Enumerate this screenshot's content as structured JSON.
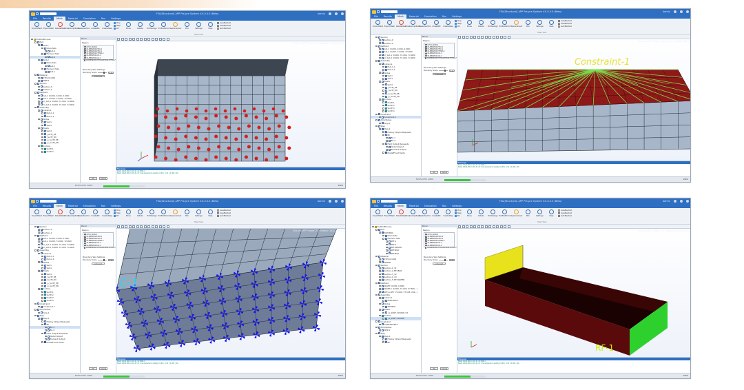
{
  "app": {
    "window_title": "FEA(Structural) APP Pre-pre System V.0.0.0.0 (Beta)",
    "quick_search": "",
    "user": "Admin",
    "tabs": [
      "File",
      "Results",
      "Mesh",
      "Material",
      "Simulation",
      "Run",
      "Settings"
    ],
    "active_tab": 2,
    "ribbon_buttons": [
      {
        "label": "ImportMesh",
        "icon": "import-icon",
        "color": "#3a6fb7"
      },
      {
        "label": "ExportMesh",
        "icon": "export-icon",
        "color": "#3a6fb7"
      },
      {
        "label": "DeleteMesh",
        "icon": "delete-icon",
        "color": "#e0463a"
      },
      {
        "label": "CreateAmplitude",
        "icon": "amplitude-icon",
        "color": "#3a6fb7"
      },
      {
        "label": "CreateSection",
        "icon": "section-icon",
        "color": "#3a6fb7"
      },
      {
        "label": "CreateBC",
        "icon": "bc-icon",
        "color": "#3a6fb7"
      },
      {
        "label": "CreateStep",
        "icon": "step-icon",
        "color": "#3a6fb7"
      }
    ],
    "ribbon_small": [
      "Prop",
      "Step",
      "BC"
    ],
    "ribbon_tools": [
      {
        "label": "Move",
        "icon": "move-icon",
        "color": "#3a6fb7"
      },
      {
        "label": "Rotate",
        "icon": "rotate-icon",
        "color": "#3a6fb7"
      },
      {
        "label": "ProfileAlign",
        "icon": "align-icon",
        "color": "#3a6fb7"
      },
      {
        "label": "ProfileMirror",
        "icon": "mirror-icon",
        "color": "#3a6fb7"
      },
      {
        "label": "Displacement",
        "icon": "displacement-icon",
        "color": "#e5a23a"
      },
      {
        "label": "Pick",
        "icon": "pick-icon",
        "color": "#3a6fb7"
      },
      {
        "label": "Settings",
        "icon": "gear-icon",
        "color": "#3a6fb7"
      },
      {
        "label": "Help",
        "icon": "help-icon",
        "color": "#3a6fb7"
      }
    ],
    "ribbon_checks": [
      "viewMeshed",
      "viewMeshed",
      "autoMeshed"
    ],
    "group_label": "Mesh Tools",
    "viewer_caption": "Struct APP Frame 2.0 Viewer 1440X900-1",
    "panel_header": "Panel",
    "panel_label": "Region",
    "panel_rows": [
      "CPS 1(1040)",
      "OLMBEZOR-HEX-2",
      "OLMBEZOR-HEX-1",
      "OLMBEZOR-TETRA-1",
      "OLMBEZOR-CO-1",
      "OLMBEZOR-CO-2",
      "OLMBEZOR-TETRA-BEZOR-TETRA-HEX"
    ],
    "panel_section": "Boundary Size Settings",
    "panel_field": "Boundary Scale",
    "panel_value": "0.16",
    "panel_apply": "solve set",
    "panel_ok": "OK",
    "panel_cancel": "Cancel",
    "msg_header": "Message",
    "msg_lines": [
      "Mesh    2022-06-01 16 41 19 SNO-1",
      "Mesh    2022-06-01 16 41 27   check element quality (0.69 | 0.12 | 0.98) | OK"
    ],
    "status_text": "Fill   0%   0    Thr 1.00%",
    "status_pct": "100%",
    "status_progress": 0.64
  },
  "windows": [
    {
      "id": "w1",
      "tree": [
        {
          "label": "PrePostProcess",
          "lvl": 0,
          "icon": "yel"
        },
        {
          "label": "Part",
          "lvl": 1,
          "icon": ""
        },
        {
          "label": "Part-1",
          "lvl": 2,
          "icon": "blu"
        },
        {
          "label": "Node Sets",
          "lvl": 3,
          "icon": ""
        },
        {
          "label": "Set-4",
          "lvl": 4,
          "icon": ""
        },
        {
          "label": "Element Sets",
          "lvl": 3,
          "icon": ""
        },
        {
          "label": "Set-4",
          "lvl": 4,
          "icon": "",
          "sel": true
        },
        {
          "label": "Part-2",
          "lvl": 2,
          "icon": "blu"
        },
        {
          "label": "Node Sets",
          "lvl": 3,
          "icon": ""
        },
        {
          "label": "Set-1",
          "lvl": 4,
          "icon": ""
        },
        {
          "label": "Element Sets",
          "lvl": 3,
          "icon": ""
        },
        {
          "label": "Set-1",
          "lvl": 4,
          "icon": ""
        },
        {
          "label": "Material",
          "lvl": 1,
          "icon": ""
        },
        {
          "label": "STP-02-1991",
          "lvl": 2,
          "icon": ""
        },
        {
          "label": "SNE71",
          "lvl": 2,
          "icon": ""
        },
        {
          "label": "Section",
          "lvl": 1,
          "icon": ""
        },
        {
          "label": "Section-0",
          "lvl": 2,
          "icon": ""
        },
        {
          "label": "Section-1",
          "lvl": 2,
          "icon": ""
        },
        {
          "label": "NetPoint",
          "lvl": 1,
          "icon": ""
        },
        {
          "label": "bot-1 (0.000, 0.000, 0.000)",
          "lvl": 2,
          "icon": ""
        },
        {
          "label": "bot-1 (0.000, 72.000, 72.000)",
          "lvl": 2,
          "icon": ""
        },
        {
          "label": "m_bot-1 (0.000, 72.000, 72.000)",
          "lvl": 2,
          "icon": ""
        },
        {
          "label": "m_bot-2 (0.000, 72.000, 72.000)",
          "lvl": 2,
          "icon": ""
        },
        {
          "label": "Assembly",
          "lvl": 1,
          "icon": ""
        },
        {
          "label": "Instance",
          "lvl": 2,
          "icon": ""
        },
        {
          "label": "Part-1-1",
          "lvl": 3,
          "icon": ""
        },
        {
          "label": "Part-2-1",
          "lvl": 3,
          "icon": ""
        },
        {
          "label": "Nodes",
          "lvl": 2,
          "icon": ""
        },
        {
          "label": "Set-1",
          "lvl": 3,
          "icon": ""
        },
        {
          "label": "Set-4",
          "lvl": 3,
          "icon": ""
        },
        {
          "label": "Elsets",
          "lvl": 2,
          "icon": ""
        },
        {
          "label": "Set-4",
          "lvl": 3,
          "icon": ""
        },
        {
          "label": "_SurfP_3B",
          "lvl": 3,
          "icon": ""
        },
        {
          "label": "_SurfP_3N",
          "lvl": 3,
          "icon": ""
        },
        {
          "label": "_p_SurfP_3B",
          "lvl": 3,
          "icon": ""
        },
        {
          "label": "_p_SurfP_3N",
          "lvl": 3,
          "icon": ""
        },
        {
          "label": "Surface",
          "lvl": 2,
          "icon": "cyn"
        },
        {
          "label": "SurfP-1",
          "lvl": 3,
          "icon": "cyn"
        },
        {
          "label": "SurfP-2",
          "lvl": 3,
          "icon": "cyn"
        }
      ],
      "scene": "nodes"
    },
    {
      "id": "w2",
      "tree": [
        {
          "label": "Section",
          "lvl": 1,
          "icon": ""
        },
        {
          "label": "Section-0",
          "lvl": 2,
          "icon": ""
        },
        {
          "label": "Section-1",
          "lvl": 2,
          "icon": ""
        },
        {
          "label": "NetPoint",
          "lvl": 1,
          "icon": ""
        },
        {
          "label": "bot-1 (0.000, 0.000, 0.000)",
          "lvl": 2,
          "icon": ""
        },
        {
          "label": "bot-1 (0.000, 72.000, 72.000)",
          "lvl": 2,
          "icon": ""
        },
        {
          "label": "m_bot-1 (0.000, 72.000, 72.000)",
          "lvl": 2,
          "icon": ""
        },
        {
          "label": "m_bot-2 (0.000, 72.000, 72.000)",
          "lvl": 2,
          "icon": ""
        },
        {
          "label": "Assembly",
          "lvl": 1,
          "icon": ""
        },
        {
          "label": "Instance",
          "lvl": 2,
          "icon": ""
        },
        {
          "label": "Part-1-1",
          "lvl": 3,
          "icon": ""
        },
        {
          "label": "Part-2-1",
          "lvl": 3,
          "icon": ""
        },
        {
          "label": "Nodes",
          "lvl": 2,
          "icon": ""
        },
        {
          "label": "Set-1",
          "lvl": 3,
          "icon": ""
        },
        {
          "label": "Set-4",
          "lvl": 3,
          "icon": ""
        },
        {
          "label": "Elsets",
          "lvl": 2,
          "icon": ""
        },
        {
          "label": "Set-4",
          "lvl": 3,
          "icon": ""
        },
        {
          "label": "_SurfP_3B",
          "lvl": 3,
          "icon": ""
        },
        {
          "label": "_SurfP_3N",
          "lvl": 3,
          "icon": ""
        },
        {
          "label": "_p_SurfP_3B",
          "lvl": 3,
          "icon": ""
        },
        {
          "label": "_p_SurfP_3N",
          "lvl": 3,
          "icon": ""
        },
        {
          "label": "Surface",
          "lvl": 2,
          "icon": "cyn"
        },
        {
          "label": "SurfP-1",
          "lvl": 3,
          "icon": "cyn"
        },
        {
          "label": "SurfP-2",
          "lvl": 3,
          "icon": "cyn"
        },
        {
          "label": "SurfP-3",
          "lvl": 3,
          "icon": "cyn"
        },
        {
          "label": "SurfP-4",
          "lvl": 3,
          "icon": "cyn"
        },
        {
          "label": "Constraint",
          "lvl": 1,
          "icon": ""
        },
        {
          "label": "Constraint-1",
          "lvl": 2,
          "icon": "",
          "sel": true
        },
        {
          "label": "Amplitudes",
          "lvl": 1,
          "icon": ""
        },
        {
          "label": "Amp-1",
          "lvl": 2,
          "icon": ""
        },
        {
          "label": "Step",
          "lvl": 1,
          "icon": ""
        },
        {
          "label": "Step-1",
          "lvl": 2,
          "icon": "blu"
        },
        {
          "label": "History Output Requests",
          "lvl": 3,
          "icon": ""
        },
        {
          "label": "BC",
          "lvl": 3,
          "icon": ""
        },
        {
          "label": "BC-1",
          "lvl": 4,
          "icon": ""
        },
        {
          "label": "BC-2",
          "lvl": 4,
          "icon": ""
        },
        {
          "label": "Field Output Requests",
          "lvl": 3,
          "icon": ""
        },
        {
          "label": "Nodal Output",
          "lvl": 4,
          "icon": ""
        },
        {
          "label": "Element Output",
          "lvl": 4,
          "icon": ""
        },
        {
          "label": "PredefFined Fields",
          "lvl": 3,
          "icon": "blu"
        }
      ],
      "scene": "constraint",
      "label": "Constraint-1"
    },
    {
      "id": "w3",
      "tree": [
        {
          "label": "Section",
          "lvl": 1,
          "icon": ""
        },
        {
          "label": "Section-0",
          "lvl": 2,
          "icon": ""
        },
        {
          "label": "Section-1",
          "lvl": 2,
          "icon": ""
        },
        {
          "label": "NetPoint",
          "lvl": 1,
          "icon": ""
        },
        {
          "label": "bot-1 (0.000, 0.000, 0.000)",
          "lvl": 2,
          "icon": ""
        },
        {
          "label": "bot-1 (0.000, 72.000, 72.000)",
          "lvl": 2,
          "icon": ""
        },
        {
          "label": "m_bot-1 (0.000, 72.000, 72.000)",
          "lvl": 2,
          "icon": ""
        },
        {
          "label": "m_bot-2 (0.000, 72.000, 72.000)",
          "lvl": 2,
          "icon": ""
        },
        {
          "label": "Assembly",
          "lvl": 1,
          "icon": ""
        },
        {
          "label": "Instance",
          "lvl": 2,
          "icon": ""
        },
        {
          "label": "Part-1-1",
          "lvl": 3,
          "icon": ""
        },
        {
          "label": "Part-2-1",
          "lvl": 3,
          "icon": ""
        },
        {
          "label": "Nodes",
          "lvl": 2,
          "icon": ""
        },
        {
          "label": "Set-1",
          "lvl": 3,
          "icon": ""
        },
        {
          "label": "Set-4",
          "lvl": 3,
          "icon": ""
        },
        {
          "label": "Elsets",
          "lvl": 2,
          "icon": ""
        },
        {
          "label": "Set-4",
          "lvl": 3,
          "icon": ""
        },
        {
          "label": "_SurfP_3B",
          "lvl": 3,
          "icon": ""
        },
        {
          "label": "_SurfP_3N",
          "lvl": 3,
          "icon": ""
        },
        {
          "label": "_p_SurfP_3B",
          "lvl": 3,
          "icon": ""
        },
        {
          "label": "_p_SurfP_3N",
          "lvl": 3,
          "icon": ""
        },
        {
          "label": "Surface",
          "lvl": 2,
          "icon": "cyn"
        },
        {
          "label": "SurfP-1",
          "lvl": 3,
          "icon": "cyn"
        },
        {
          "label": "SurfP-2",
          "lvl": 3,
          "icon": "cyn"
        },
        {
          "label": "SurfP-3",
          "lvl": 3,
          "icon": "cyn"
        },
        {
          "label": "SurfP-4",
          "lvl": 3,
          "icon": "cyn"
        },
        {
          "label": "Constraint",
          "lvl": 1,
          "icon": ""
        },
        {
          "label": "Constraint-1",
          "lvl": 2,
          "icon": ""
        },
        {
          "label": "Amplitudes",
          "lvl": 1,
          "icon": ""
        },
        {
          "label": "Amp-1",
          "lvl": 2,
          "icon": ""
        },
        {
          "label": "Step",
          "lvl": 1,
          "icon": ""
        },
        {
          "label": "Step-1",
          "lvl": 2,
          "icon": "blu"
        },
        {
          "label": "History Output Requests",
          "lvl": 3,
          "icon": ""
        },
        {
          "label": "BC",
          "lvl": 3,
          "icon": ""
        },
        {
          "label": "BC-1",
          "lvl": 4,
          "icon": "",
          "sel": true
        },
        {
          "label": "BC-2",
          "lvl": 4,
          "icon": ""
        },
        {
          "label": "Field Output Requests",
          "lvl": 3,
          "icon": ""
        },
        {
          "label": "Nodal Output",
          "lvl": 4,
          "icon": ""
        },
        {
          "label": "Element Output",
          "lvl": 4,
          "icon": ""
        },
        {
          "label": "PredefFined Fields",
          "lvl": 3,
          "icon": "blu"
        }
      ],
      "scene": "bc",
      "label": "C-1"
    },
    {
      "id": "w4",
      "tree": [
        {
          "label": "PrePostProcess",
          "lvl": 0,
          "icon": "yel"
        },
        {
          "label": "Part",
          "lvl": 1,
          "icon": ""
        },
        {
          "label": "PART-BOX",
          "lvl": 2,
          "icon": "blu"
        },
        {
          "label": "Node Sets",
          "lvl": 3,
          "icon": ""
        },
        {
          "label": "Element Sets",
          "lvl": 3,
          "icon": ""
        },
        {
          "label": "SET-1",
          "lvl": 4,
          "icon": ""
        },
        {
          "label": "SET-2",
          "lvl": 4,
          "icon": ""
        },
        {
          "label": "SET-WATER",
          "lvl": 4,
          "icon": ""
        },
        {
          "label": "SET-BOX",
          "lvl": 4,
          "icon": ""
        },
        {
          "label": "SET-BOX",
          "lvl": 4,
          "icon": ""
        },
        {
          "label": "Material",
          "lvl": 1,
          "icon": ""
        },
        {
          "label": "STP-02-1991",
          "lvl": 2,
          "icon": ""
        },
        {
          "label": "WATER",
          "lvl": 2,
          "icon": ""
        },
        {
          "label": "Section",
          "lvl": 1,
          "icon": ""
        },
        {
          "label": "Section-1_11",
          "lvl": 2,
          "icon": ""
        },
        {
          "label": "Section-2-SET-BOX",
          "lvl": 2,
          "icon": ""
        },
        {
          "label": "Section-3_12",
          "lvl": 2,
          "icon": ""
        },
        {
          "label": "Section-4_13",
          "lvl": 2,
          "icon": ""
        },
        {
          "label": "Section-5-SET-WATER",
          "lvl": 2,
          "icon": ""
        },
        {
          "label": "NetPoint",
          "lvl": 1,
          "icon": ""
        },
        {
          "label": "NLSET (0.000, 0.000)",
          "lvl": 2,
          "icon": ""
        },
        {
          "label": "NLSET-1 (0.000, 72.000, 57.505...)",
          "lvl": 2,
          "icon": ""
        },
        {
          "label": "SET-G-SET (74.000, 57.505, 292...)",
          "lvl": 2,
          "icon": ""
        },
        {
          "label": "Assembly",
          "lvl": 1,
          "icon": ""
        },
        {
          "label": "Instance",
          "lvl": 2,
          "icon": ""
        },
        {
          "label": "PART-BOX-1",
          "lvl": 3,
          "icon": ""
        },
        {
          "label": "Nodes",
          "lvl": 2,
          "icon": ""
        },
        {
          "label": "SET-BOX",
          "lvl": 3,
          "icon": ""
        },
        {
          "label": "Elsets",
          "lvl": 2,
          "icon": ""
        },
        {
          "label": "_G_SURF-COUPLE_S3",
          "lvl": 3,
          "icon": ""
        },
        {
          "label": "Surface",
          "lvl": 2,
          "icon": "cyn"
        },
        {
          "label": "_G_SURF-COUPLE",
          "lvl": 3,
          "icon": "cyn",
          "sel": true
        },
        {
          "label": "Constraint",
          "lvl": 1,
          "icon": ""
        },
        {
          "label": "CONSTRAINT-1",
          "lvl": 2,
          "icon": ""
        },
        {
          "label": "Amplitudes",
          "lvl": 1,
          "icon": ""
        },
        {
          "label": "AMP-1",
          "lvl": 2,
          "icon": ""
        },
        {
          "label": "Step",
          "lvl": 1,
          "icon": ""
        },
        {
          "label": "Step-1",
          "lvl": 2,
          "icon": "blu"
        },
        {
          "label": "History Output Requests",
          "lvl": 3,
          "icon": ""
        },
        {
          "label": "BC",
          "lvl": 3,
          "icon": ""
        }
      ],
      "scene": "surface",
      "label": "RF-1"
    }
  ],
  "colors": {
    "titlebar": "#2e6fc2",
    "mesh_face": "#a7b7c9",
    "mesh_line": "#1f2b39",
    "node": "#d31f1f",
    "constraint_face": "#8e1919",
    "constraint_line": "#7be04a",
    "constraint_label": "#e8e23a",
    "bc_arrow": "#1313f0",
    "bc_label": "#2fd4f0",
    "surf_yellow": "#e8e21c",
    "surf_green": "#2ed02e",
    "surf_label": "#c8f000"
  }
}
